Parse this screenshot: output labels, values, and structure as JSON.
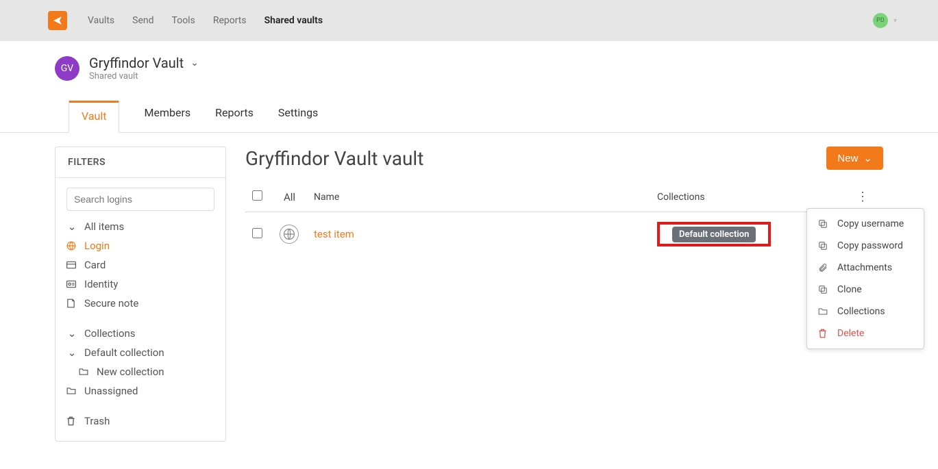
{
  "topnav": {
    "items": [
      "Vaults",
      "Send",
      "Tools",
      "Reports",
      "Shared vaults"
    ],
    "active_index": 4
  },
  "user": {
    "initials": "PD"
  },
  "vault": {
    "initials": "GV",
    "name": "Gryffindor Vault",
    "subtitle": "Shared vault"
  },
  "tabs": {
    "items": [
      "Vault",
      "Members",
      "Reports",
      "Settings"
    ],
    "active_index": 0
  },
  "sidebar": {
    "title": "FILTERS",
    "search_placeholder": "Search logins",
    "all_items": "All items",
    "login": "Login",
    "card": "Card",
    "identity": "Identity",
    "secure_note": "Secure note",
    "collections": "Collections",
    "default_collection": "Default collection",
    "new_collection": "New collection",
    "unassigned": "Unassigned",
    "trash": "Trash"
  },
  "main": {
    "title": "Gryffindor Vault vault",
    "new_label": "New",
    "columns": {
      "all": "All",
      "name": "Name",
      "collections": "Collections"
    },
    "rows": [
      {
        "name": "test item",
        "collection_badge": "Default collection"
      }
    ]
  },
  "context_menu": {
    "copy_username": "Copy username",
    "copy_password": "Copy password",
    "attachments": "Attachments",
    "clone": "Clone",
    "collections": "Collections",
    "delete": "Delete"
  }
}
